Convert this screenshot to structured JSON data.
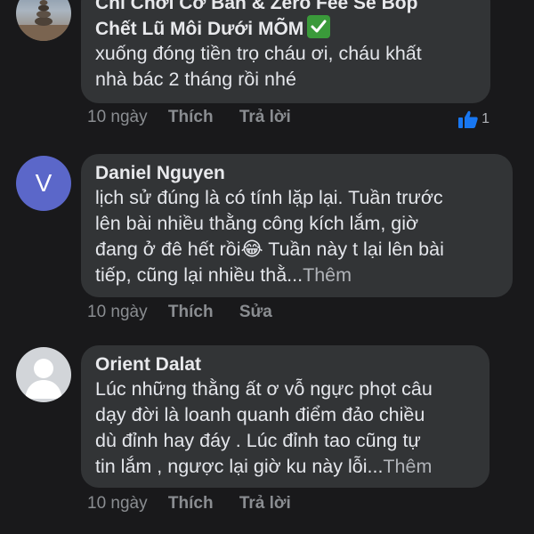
{
  "comments": [
    {
      "author": "Chỉ Chơi Cơ Bản & Zero Fee Sẽ Bóp",
      "author_line2": "Chết Lũ Môi Dưới MÕM",
      "verified_icon": "check-mark-button",
      "lines": [
        "xuống đóng tiền trọ cháu ơi, cháu khất",
        "nhà bác 2 tháng rồi nhé"
      ],
      "time": "10 ngày",
      "action1": "Thích",
      "action2": "Trả lời",
      "reaction_count": "1"
    },
    {
      "author": "Daniel Nguyen",
      "avatar_letter": "V",
      "lines": [
        "lịch sử đúng là có tính lặp lại. Tuần trước",
        "lên bài nhiều thằng công kích lắm, giờ",
        "đang ở đê hết rồi",
        "Tuần này t lại lên bài",
        "tiếp, cũng lại nhiều thằ..."
      ],
      "emoji": "😂",
      "more": "Thêm",
      "time": "10 ngày",
      "action1": "Thích",
      "action2": "Sửa"
    },
    {
      "author": "Orient Dalat",
      "lines": [
        "Lúc những thằng ất ơ vỗ ngực phọt câu",
        "dạy đời là loanh quanh điểm  đảo chiều",
        "dù đỉnh hay đáy . Lúc đỉnh tao cũng tự",
        "tin lắm , ngược lại giờ ku này lỗi..."
      ],
      "more": "Thêm",
      "time": "10 ngày",
      "action1": "Thích",
      "action2": "Trả lời"
    }
  ],
  "colors": {
    "background": "#19191b",
    "bubble": "#323436",
    "text": "#e4e6eb",
    "muted": "#8a8d91",
    "like_blue": "#1877f2",
    "avatar_v": "#5b67c9"
  }
}
